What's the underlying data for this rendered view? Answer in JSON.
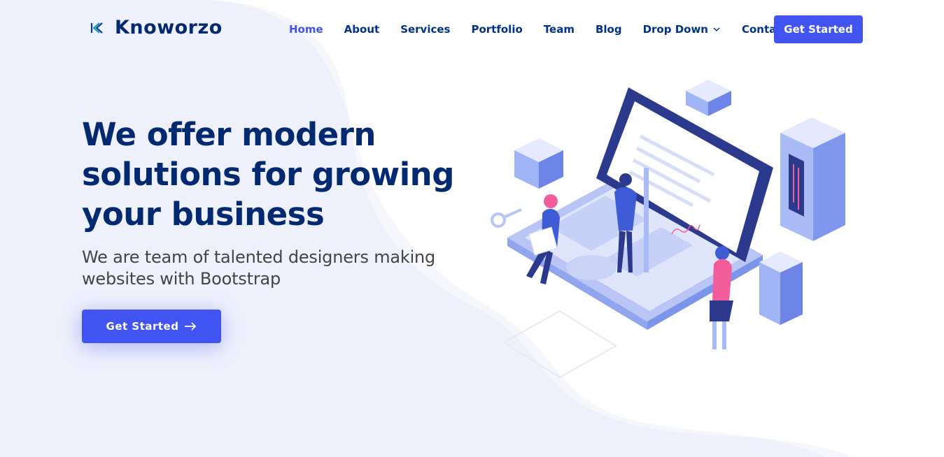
{
  "brand": {
    "name": "Knoworzo",
    "accent": "#4154f1",
    "primary": "#012970"
  },
  "nav": {
    "items": [
      {
        "label": "Home",
        "active": true
      },
      {
        "label": "About",
        "active": false
      },
      {
        "label": "Services",
        "active": false
      },
      {
        "label": "Portfolio",
        "active": false
      },
      {
        "label": "Team",
        "active": false
      },
      {
        "label": "Blog",
        "active": false
      },
      {
        "label": "Drop Down",
        "active": false,
        "icon": "chevron-down-icon"
      },
      {
        "label": "Contact",
        "active": false
      }
    ],
    "cta_label": "Get Started"
  },
  "hero": {
    "title": "We offer modern solutions for growing your business",
    "subtitle": "We are team of talented designers making websites with Bootstrap",
    "button_label": "Get Started",
    "button_icon": "arrow-right-icon",
    "illustration": "team-working-isometric-illustration"
  }
}
